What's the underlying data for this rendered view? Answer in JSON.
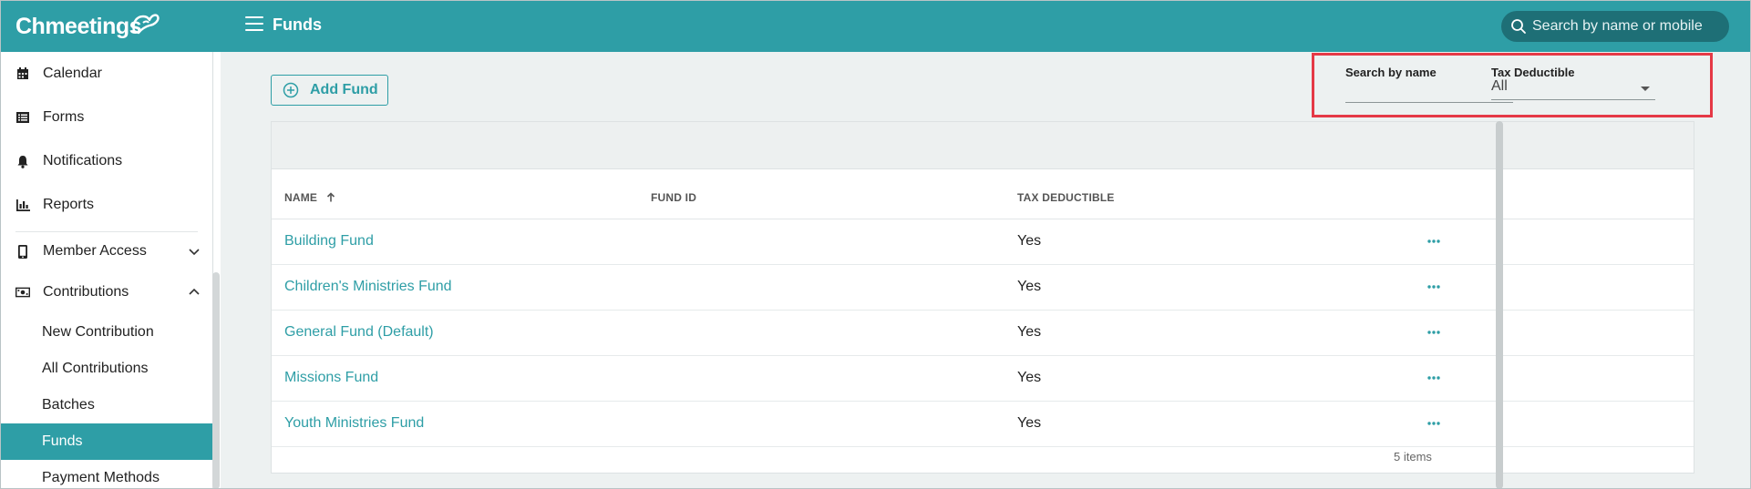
{
  "app": {
    "logo_text": "Chmeetings",
    "page_title": "Funds"
  },
  "search": {
    "placeholder": "Search by name or mobile"
  },
  "sidebar": {
    "items": [
      {
        "label": "Calendar",
        "icon": "calendar-icon"
      },
      {
        "label": "Forms",
        "icon": "forms-icon"
      },
      {
        "label": "Notifications",
        "icon": "bell-icon"
      },
      {
        "label": "Reports",
        "icon": "reports-icon"
      },
      {
        "label": "Member Access",
        "icon": "phone-icon"
      },
      {
        "label": "Contributions",
        "icon": "money-icon"
      }
    ],
    "sub_items": [
      {
        "label": "New Contribution"
      },
      {
        "label": "All Contributions"
      },
      {
        "label": "Batches"
      },
      {
        "label": "Funds",
        "active": true
      },
      {
        "label": "Payment Methods"
      }
    ]
  },
  "toolbar": {
    "add_label": "Add Fund"
  },
  "filters": {
    "name_label": "Search by name",
    "name_value": "",
    "tax_label": "Tax Deductible",
    "tax_value": "All"
  },
  "table": {
    "columns": [
      "NAME",
      "FUND ID",
      "TAX DEDUCTIBLE"
    ],
    "sort": {
      "column": "NAME",
      "direction": "ascending"
    },
    "rows": [
      {
        "name": "Building Fund",
        "fund_id": "",
        "tax": "Yes"
      },
      {
        "name": "Children's Ministries Fund",
        "fund_id": "",
        "tax": "Yes"
      },
      {
        "name": "General Fund (Default)",
        "fund_id": "",
        "tax": "Yes"
      },
      {
        "name": "Missions Fund",
        "fund_id": "",
        "tax": "Yes"
      },
      {
        "name": "Youth Ministries Fund",
        "fund_id": "",
        "tax": "Yes"
      }
    ],
    "items_count": "5 items"
  },
  "colors": {
    "brand": "#2e9ea6",
    "brand_dark": "#1e6f76",
    "highlight": "#e53946",
    "content_bg": "#edf1f1"
  }
}
